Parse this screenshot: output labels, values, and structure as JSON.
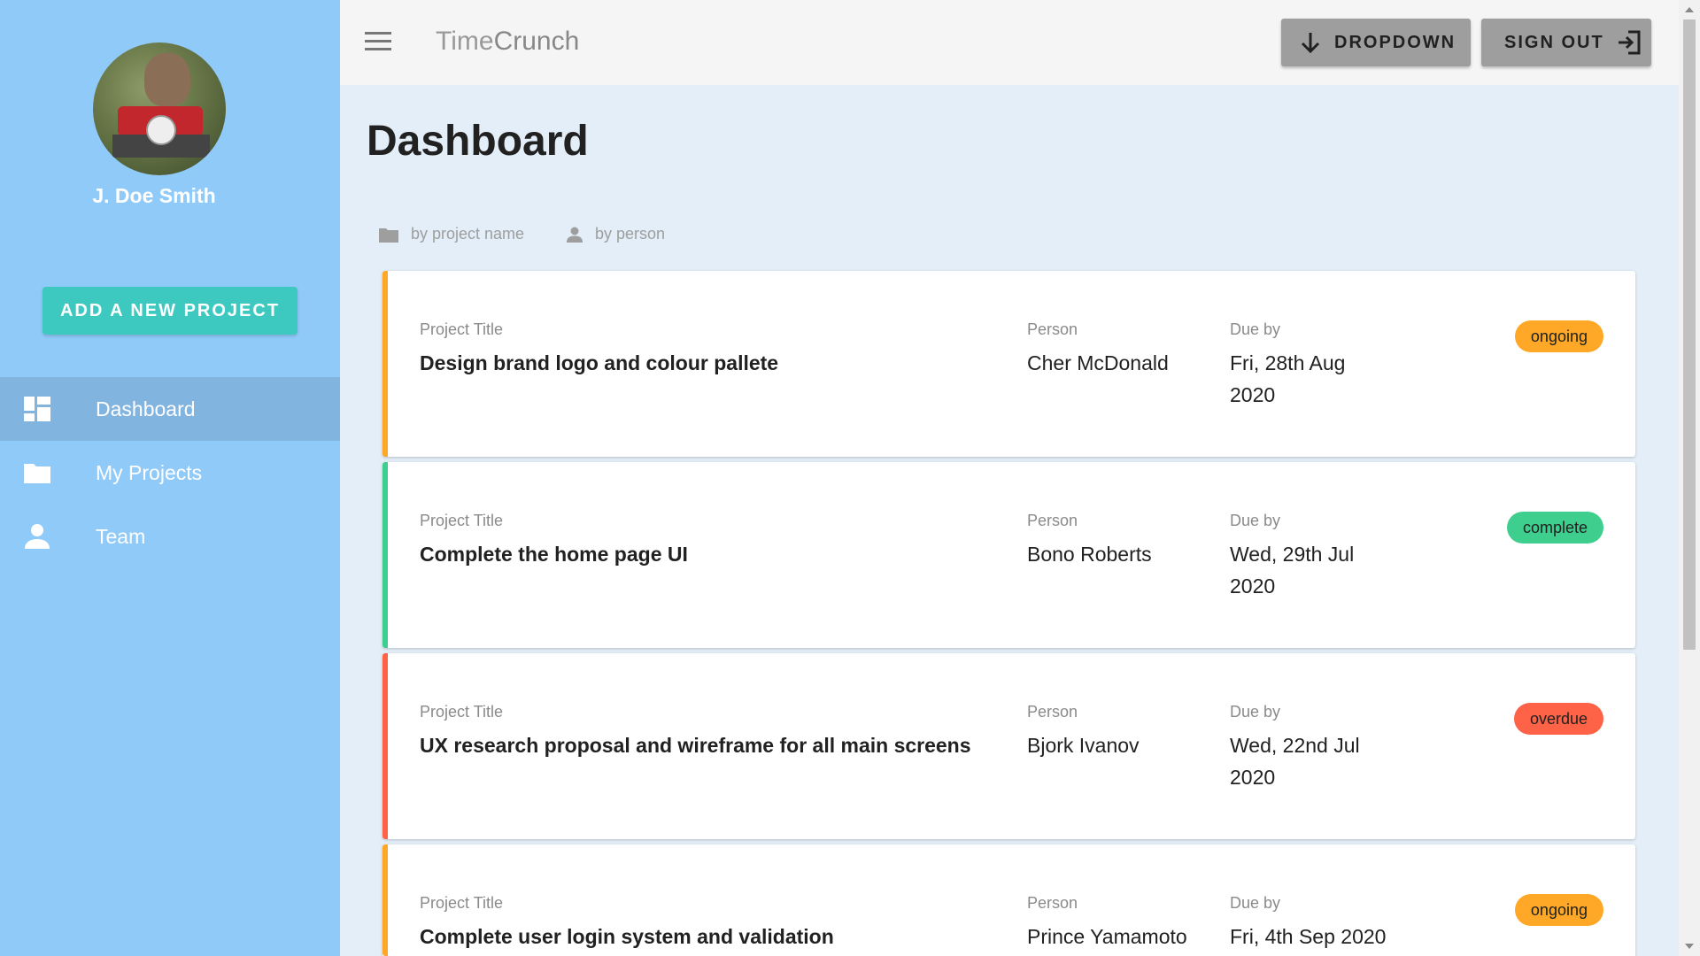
{
  "sidebar": {
    "user_name": "J. Doe Smith",
    "add_button": "ADD A NEW PROJECT",
    "items": [
      {
        "label": "Dashboard",
        "icon": "dashboard-icon",
        "active": true
      },
      {
        "label": "My Projects",
        "icon": "folder-icon",
        "active": false
      },
      {
        "label": "Team",
        "icon": "person-icon",
        "active": false
      }
    ]
  },
  "header": {
    "brand_light": "Time",
    "brand_bold": "Crunch",
    "dropdown_label": "DROPDOWN",
    "signout_label": "SIGN OUT"
  },
  "main": {
    "title": "Dashboard",
    "filters": [
      {
        "label": "by project name",
        "icon": "folder-icon"
      },
      {
        "label": "by person",
        "icon": "person-icon"
      }
    ],
    "labels": {
      "title": "Project Title",
      "person": "Person",
      "due": "Due by"
    },
    "projects": [
      {
        "title": "Design brand logo and colour pallete",
        "person": "Cher McDonald",
        "due": "Fri, 28th Aug 2020",
        "status": "ongoing"
      },
      {
        "title": "Complete the home page UI",
        "person": "Bono Roberts",
        "due": "Wed, 29th Jul 2020",
        "status": "complete"
      },
      {
        "title": "UX research proposal and wireframe for all main screens",
        "person": "Bjork Ivanov",
        "due": "Wed, 22nd Jul 2020",
        "status": "overdue"
      },
      {
        "title": "Complete user login system and validation",
        "person": "Prince Yamamoto",
        "due": "Fri, 4th Sep 2020",
        "status": "ongoing"
      }
    ]
  },
  "colors": {
    "ongoing": "#ffa726",
    "complete": "#3ecf8e",
    "overdue": "#ff6347",
    "sidebar": "#90caf9",
    "accent": "#3ec9c0"
  }
}
